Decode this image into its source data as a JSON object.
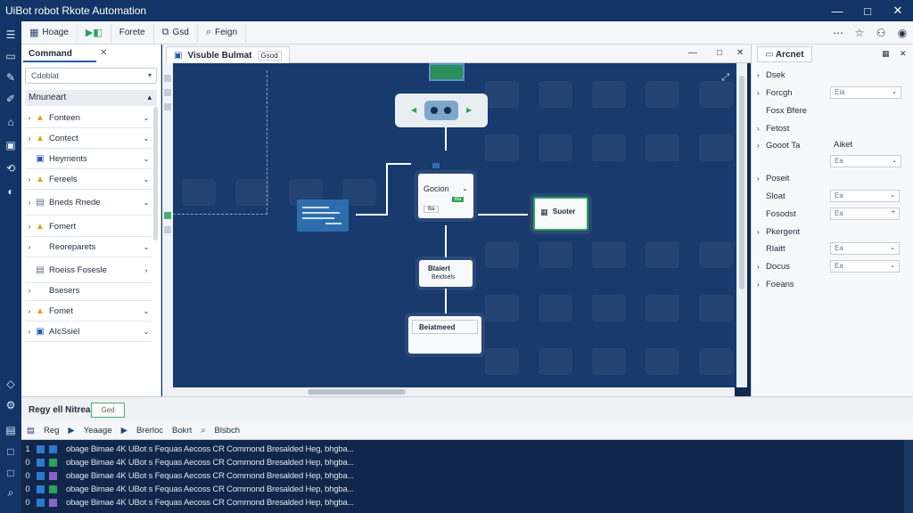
{
  "app": {
    "title": "UiBot robot Rkote Automation"
  },
  "window_controls": [
    "—",
    "□",
    "✕"
  ],
  "toolbar": {
    "buttons": [
      {
        "label": "Hoage",
        "icon": "grid-icon"
      },
      {
        "label": "",
        "icon": "run-icon"
      },
      {
        "label": "Forete",
        "icon": "edit-icon"
      },
      {
        "label": "Gsd",
        "icon": "copy-icon"
      },
      {
        "label": "Feign",
        "icon": "search-icon"
      }
    ],
    "right_icons": [
      "more-icon",
      "star-icon",
      "user-icon",
      "avatar-icon"
    ]
  },
  "command_panel": {
    "tab": "Command",
    "search_value": "Cdoblat",
    "section": "Mnuneart",
    "items": [
      {
        "expand": "›",
        "icon": "tri",
        "label": "Fonteen",
        "chevron": "⌄"
      },
      {
        "expand": "›",
        "icon": "tri",
        "label": "Contect",
        "chevron": "⌄"
      },
      {
        "expand": "",
        "icon": "sq",
        "label": "Heyments",
        "chevron": "⌄"
      },
      {
        "expand": "›",
        "icon": "tri",
        "label": "Fereels",
        "chevron": "⌄"
      },
      {
        "expand": "›",
        "icon": "doc",
        "label": "Bneds Rnede",
        "chevron": "⌄"
      },
      {
        "expand": "›",
        "icon": "tri",
        "label": "Fomert",
        "chevron": ""
      },
      {
        "expand": "›",
        "icon": "",
        "label": "Reoreparets",
        "chevron": "⌄"
      },
      {
        "expand": "",
        "icon": "doc",
        "label": "Roeiss Fosesle",
        "chevron": "›"
      },
      {
        "expand": "›",
        "icon": "",
        "label": "Bsesers",
        "chevron": ""
      },
      {
        "expand": "›",
        "icon": "tri",
        "label": "Fomet",
        "chevron": "⌄"
      },
      {
        "expand": "›",
        "icon": "sq",
        "label": "AIcSsiel",
        "chevron": "⌄"
      }
    ]
  },
  "editor": {
    "tab_title": "Visuble Bulmat",
    "tab_badge": "Gsod",
    "window_icons": [
      "—",
      "□",
      "✕"
    ]
  },
  "flow": {
    "node_decision": {
      "title": "Gocion",
      "badge": "Ba",
      "button": "Ba"
    },
    "node_right": {
      "title": "Suoter"
    },
    "node_middle": {
      "title": "Blaiert",
      "subtitle": "Beidsels"
    },
    "node_bottom": {
      "title": "Beiatmeed"
    },
    "colors": {
      "canvas": "#183a6c",
      "accent_green": "#2ba35a",
      "node_blue": "#2e6dad"
    }
  },
  "properties": {
    "tab": "Arcnet",
    "rows": [
      {
        "expand": "›",
        "label": "Dsek",
        "field": "",
        "dd": ""
      },
      {
        "expand": "›",
        "label": "Forcgh",
        "field": "Eia",
        "dd": "⌄"
      },
      {
        "expand": "",
        "label": "Fosx Bfere",
        "field": "",
        "dd": ""
      },
      {
        "expand": "›",
        "label": "Fetost",
        "field": "",
        "dd": ""
      },
      {
        "expand": "›",
        "label": "Gooot Ta",
        "field": "Aiket",
        "dd": ""
      },
      {
        "expand": "",
        "label": "",
        "field": "Ea",
        "dd": "⌄"
      },
      {
        "expand": "›",
        "label": "Poseit",
        "field": "",
        "dd": ""
      },
      {
        "expand": "",
        "label": "Sloat",
        "field": "Ea",
        "dd": "⌄"
      },
      {
        "expand": "",
        "label": "Fosodst",
        "field": "Ea",
        "dd": "+"
      },
      {
        "expand": "›",
        "label": "Pkergent",
        "field": "",
        "dd": ""
      },
      {
        "expand": "",
        "label": "Rlaitt",
        "field": "Ea",
        "dd": "⌄"
      },
      {
        "expand": "›",
        "label": "Docus",
        "field": "Ea",
        "dd": "⌄"
      },
      {
        "expand": "›",
        "label": "Foeans",
        "field": "",
        "dd": ""
      }
    ]
  },
  "output": {
    "tab": "Regy ell Nitrea",
    "badge": "Ged",
    "toolbar": [
      "Reg",
      "Yeaage",
      "Brerloc",
      "Bokrt",
      "Blsbch"
    ],
    "rows": [
      {
        "n": "1",
        "color": "#2a7bd0",
        "text": "obage Bimae 4K UBot s Fequas Aecoss CR Commond Bresalded Heg, bhgba..."
      },
      {
        "n": "0",
        "color": "#2ba35a",
        "text": "obage Bimae 4K UBot s Fequas Aecoss CR Commond Bresalded Hep, bhgba..."
      },
      {
        "n": "0",
        "color": "#8a63c9",
        "text": "obage Bimae 4K UBot s Fequas Aecoss CR Commond Bresalded Hep, bhgba..."
      },
      {
        "n": "0",
        "color": "#2ba35a",
        "text": "obage Bimae 4K UBot s Fequas Aecoss CR Commond Bresalded Hep, bhgba..."
      },
      {
        "n": "0",
        "color": "#8a63c9",
        "text": "obage Bimae 4K UBot s Fequas Aecoss CR Commond Bresalded Hep, bhgba..."
      }
    ]
  }
}
